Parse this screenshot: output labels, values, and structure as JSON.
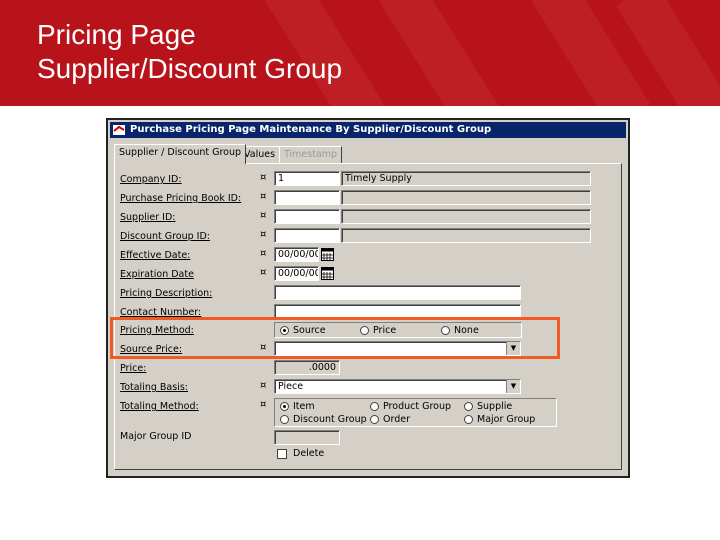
{
  "slide": {
    "title_line1": "Pricing Page",
    "title_line2": "Supplier/Discount Group"
  },
  "window": {
    "title": "Purchase Pricing Page Maintenance By Supplier/Discount Group",
    "tabs": [
      {
        "label": "Supplier / Discount Group",
        "state": "active"
      },
      {
        "label": "Values",
        "state": "normal"
      },
      {
        "label": "Timestamp",
        "state": "disabled"
      }
    ]
  },
  "form": {
    "company_id": {
      "label": "Company ID:",
      "value": "1",
      "desc": "Timely Supply"
    },
    "pricing_book_id": {
      "label": "Purchase Pricing Book ID:",
      "value": "",
      "desc": ""
    },
    "supplier_id": {
      "label": "Supplier ID:",
      "value": "",
      "desc": ""
    },
    "discount_group_id": {
      "label": "Discount Group ID:",
      "value": "",
      "desc": ""
    },
    "effective_date": {
      "label": "Effective Date:",
      "value": "00/00/00"
    },
    "expiration_date": {
      "label": "Expiration Date",
      "value": "00/00/00"
    },
    "pricing_description": {
      "label": "Pricing Description:",
      "value": ""
    },
    "contact_number": {
      "label": "Contact Number:",
      "value": ""
    },
    "pricing_method": {
      "label": "Pricing Method:",
      "options": [
        "Source",
        "Price",
        "None"
      ],
      "selected": "Source"
    },
    "source_price": {
      "label": "Source Price:",
      "value": ""
    },
    "price": {
      "label": "Price:",
      "value": ".0000"
    },
    "totaling_basis": {
      "label": "Totaling Basis:",
      "value": "Piece"
    },
    "totaling_method": {
      "label": "Totaling Method:",
      "options": [
        "Item",
        "Product Group",
        "Supplie",
        "Discount Group",
        "Order",
        "Major Group"
      ],
      "selected": "Item"
    },
    "major_group_id": {
      "label": "Major Group ID",
      "value": ""
    },
    "delete": {
      "label": "Delete",
      "checked": false
    },
    "required_mark": "¤"
  },
  "colors": {
    "banner": "#b8131a",
    "titlebar": "#08246b",
    "highlight": "#f15a22",
    "dialog": "#d4d0c8"
  },
  "icons": [
    "app-icon",
    "calendar-icon",
    "dropdown-arrow-icon"
  ]
}
